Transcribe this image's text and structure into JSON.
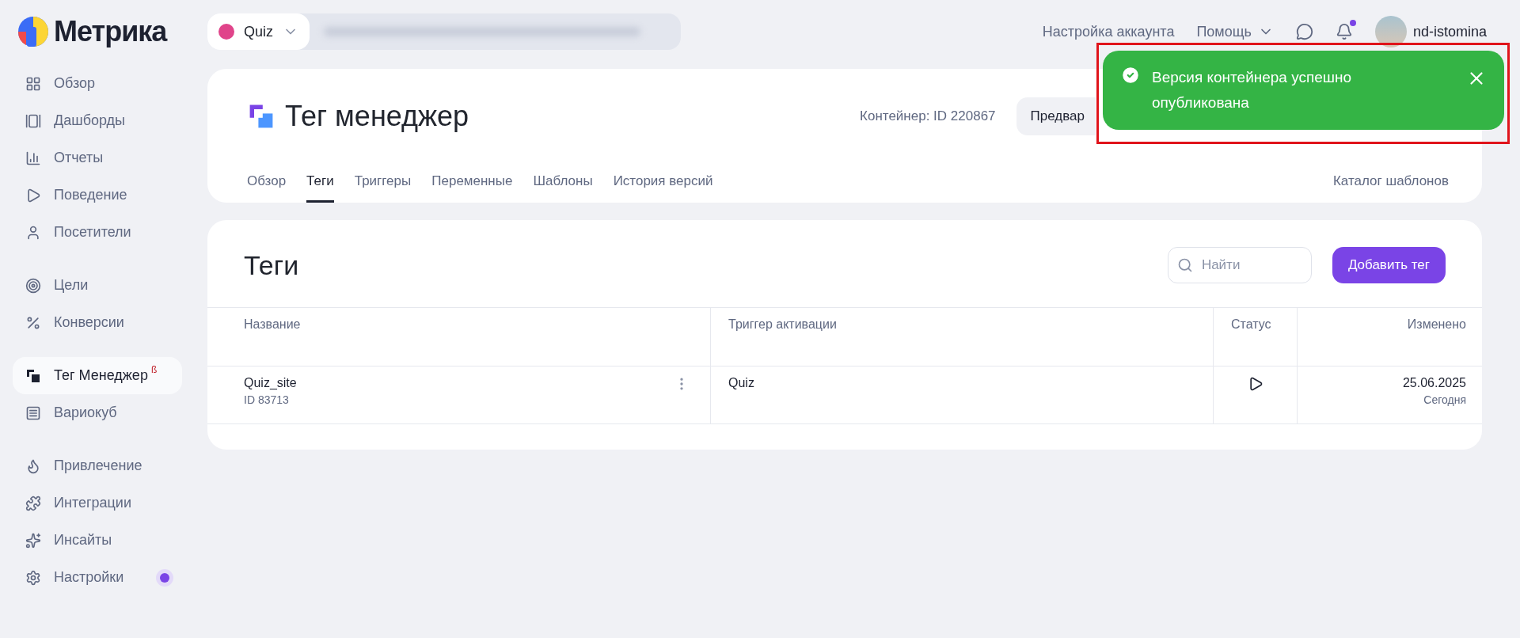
{
  "logo": {
    "text": "Метрика"
  },
  "counter": {
    "name": "Quiz",
    "color": "#e0448a"
  },
  "top_links": {
    "account": "Настройка аккаунта",
    "help": "Помощь",
    "user": "nd-istomina",
    "notification_dot": true
  },
  "sidebar": {
    "groups": [
      [
        {
          "label": "Обзор",
          "selected": false
        },
        {
          "label": "Дашборды",
          "selected": false
        },
        {
          "label": "Отчеты",
          "selected": false
        },
        {
          "label": "Поведение",
          "selected": false
        },
        {
          "label": "Посетители",
          "selected": false
        }
      ],
      [
        {
          "label": "Цели",
          "selected": false
        },
        {
          "label": "Конверсии",
          "selected": false
        }
      ],
      [
        {
          "label": "Тег Менеджер",
          "selected": true,
          "badge": "ß"
        },
        {
          "label": "Вариокуб",
          "selected": false
        }
      ],
      [
        {
          "label": "Привлечение",
          "selected": false
        },
        {
          "label": "Интеграции",
          "selected": false
        },
        {
          "label": "Инсайты",
          "selected": false
        },
        {
          "label": "Настройки",
          "selected": false,
          "dot": true
        }
      ]
    ]
  },
  "header": {
    "title": "Тег менеджер",
    "container": "Контейнер: ID 220867",
    "preview_button": "Предвар",
    "tabs": [
      {
        "label": "Обзор",
        "selected": false
      },
      {
        "label": "Теги",
        "selected": true
      },
      {
        "label": "Триггеры",
        "selected": false
      },
      {
        "label": "Переменные",
        "selected": false
      },
      {
        "label": "Шаблоны",
        "selected": false
      },
      {
        "label": "История версий",
        "selected": false
      }
    ],
    "catalog_link": "Каталог шаблонов"
  },
  "tags": {
    "title": "Теги",
    "search": {
      "placeholder": "Найти"
    },
    "add_button": "Добавить тег",
    "columns": [
      "Название",
      "Триггер активации",
      "Статус",
      "Изменено"
    ],
    "rows": [
      {
        "name": "Quiz_site",
        "id": "ID 83713",
        "trigger": "Quiz",
        "running": true,
        "date": "25.06.2025",
        "relative": "Сегодня"
      }
    ]
  },
  "toast": {
    "message": "Версия контейнера успешно опубликована",
    "kind": "success"
  },
  "highlight_frame": true
}
